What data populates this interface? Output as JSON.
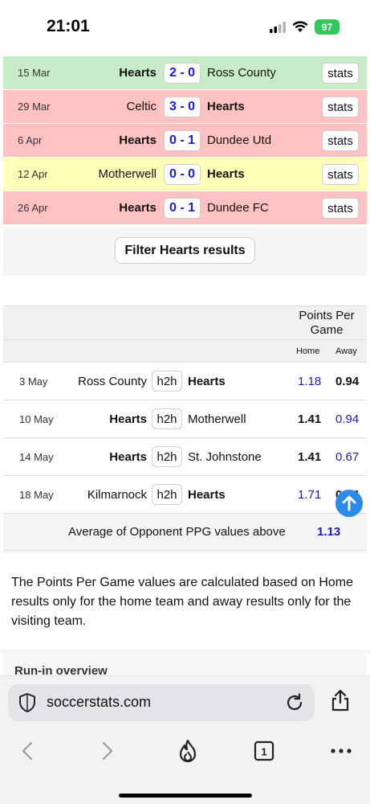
{
  "status_bar": {
    "time": "21:01",
    "battery": "97"
  },
  "results": [
    {
      "date": "15 Mar",
      "home": "Hearts",
      "home_bold": true,
      "score": "2 - 0",
      "away": "Ross County",
      "away_bold": false,
      "color": "#c7ecc7",
      "stats": "stats"
    },
    {
      "date": "29 Mar",
      "home": "Celtic",
      "home_bold": false,
      "score": "3 - 0",
      "away": "Hearts",
      "away_bold": true,
      "color": "#ffc2c2",
      "stats": "stats"
    },
    {
      "date": "6 Apr",
      "home": "Hearts",
      "home_bold": true,
      "score": "0 - 1",
      "away": "Dundee Utd",
      "away_bold": false,
      "color": "#ffc2c2",
      "stats": "stats"
    },
    {
      "date": "12 Apr",
      "home": "Motherwell",
      "home_bold": false,
      "score": "0 - 0",
      "away": "Hearts",
      "away_bold": true,
      "color": "#ffffb8",
      "stats": "stats"
    },
    {
      "date": "26 Apr",
      "home": "Hearts",
      "home_bold": true,
      "score": "0 - 1",
      "away": "Dundee FC",
      "away_bold": false,
      "color": "#ffc2c2",
      "stats": "stats"
    }
  ],
  "filter_button": "Filter Hearts results",
  "fixtures": {
    "ppg_title": "Points Per Game",
    "col_home": "Home",
    "col_away": "Away",
    "rows": [
      {
        "date": "3 May",
        "home": "Ross County",
        "home_bold": false,
        "h2h": "h2h",
        "away": "Hearts",
        "away_bold": true,
        "ppg_home": "1.18",
        "ppg_home_opp": true,
        "ppg_away": "0.94",
        "ppg_away_opp": false
      },
      {
        "date": "10 May",
        "home": "Hearts",
        "home_bold": true,
        "h2h": "h2h",
        "away": "Motherwell",
        "away_bold": false,
        "ppg_home": "1.41",
        "ppg_home_opp": false,
        "ppg_away": "0.94",
        "ppg_away_opp": true
      },
      {
        "date": "14 May",
        "home": "Hearts",
        "home_bold": true,
        "h2h": "h2h",
        "away": "St. Johnstone",
        "away_bold": false,
        "ppg_home": "1.41",
        "ppg_home_opp": false,
        "ppg_away": "0.67",
        "ppg_away_opp": true
      },
      {
        "date": "18 May",
        "home": "Kilmarnock",
        "home_bold": false,
        "h2h": "h2h",
        "away": "Hearts",
        "away_bold": true,
        "ppg_home": "1.71",
        "ppg_home_opp": true,
        "ppg_away": "0.94",
        "ppg_away_opp": false
      }
    ],
    "average_label": "Average of Opponent PPG values above",
    "average_value": "1.13"
  },
  "explanation": "The Points Per Game values are calculated based on Home results only for the home team and away results only for the visiting team.",
  "runin_heading": "Run-in overview",
  "browser": {
    "url": "soccerstats.com",
    "tab_count": "1"
  },
  "icons": {
    "signal": "signal-icon",
    "wifi": "wifi-icon",
    "battery": "battery-icon",
    "scroll_up": "arrow-up-icon",
    "shield": "shield-icon",
    "reload": "reload-icon",
    "share": "share-icon",
    "back": "back-icon",
    "forward": "forward-icon",
    "fire": "fire-icon",
    "tabs": "tabs-icon",
    "more": "more-icon"
  }
}
